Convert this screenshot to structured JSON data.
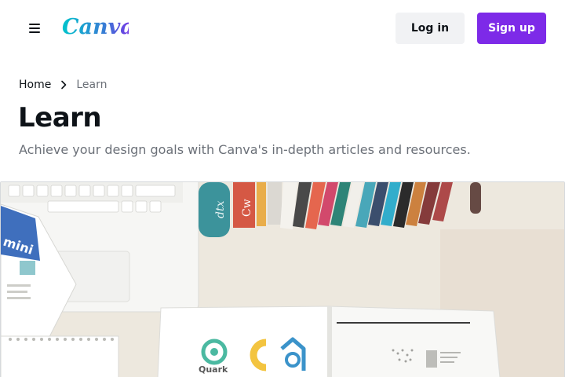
{
  "header": {
    "logo_text": "Canva",
    "login_label": "Log in",
    "signup_label": "Sign up",
    "menu_icon": "hamburger-icon"
  },
  "breadcrumb": {
    "items": [
      "Home",
      "Learn"
    ],
    "separator_icon": "chevron-right-icon"
  },
  "page": {
    "title": "Learn",
    "subtitle": "Achieve your design goals with Canva's in-depth articles and resources."
  },
  "hero": {
    "book_spine_1": "dtx",
    "book_spine_2": "Cw",
    "pamphlet_text": "mini",
    "notebook_brand": "Quark"
  },
  "colors": {
    "brand_purple": "#7d2ae8",
    "logo_gradient_start": "#00c4cc",
    "logo_gradient_end": "#7d2ae8",
    "login_bg": "#f1f2f4",
    "text_primary": "#0e1318",
    "text_muted": "#6b7078"
  }
}
